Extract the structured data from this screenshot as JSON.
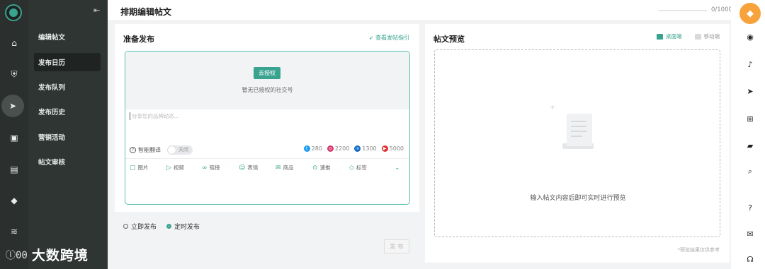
{
  "header": {
    "title": "排期编辑帖文",
    "counter": "0/1000",
    "progress": 0
  },
  "subnav": {
    "items": [
      {
        "label": "编辑帖文"
      },
      {
        "label": "发布日历"
      },
      {
        "label": "发布队列"
      },
      {
        "label": "发布历史"
      },
      {
        "label": "营销活动"
      },
      {
        "label": "帖文审核"
      }
    ],
    "active": "发布日历"
  },
  "rail_icons": [
    "app-logo-icon",
    "home-icon",
    "shield-icon",
    "send-icon",
    "chat-icon",
    "document-icon",
    "tag-icon",
    "layers-icon"
  ],
  "brand": {
    "mark": "ⓛ00",
    "text": "大数跨境"
  },
  "compose": {
    "title": "准备发布",
    "guide_link": "查看发帖指引",
    "auth_button": "去授权",
    "auth_hint": "暂无已授权的社交号",
    "placeholder": "分享您的品牌动态...",
    "translate_label": "智能翻译",
    "translate_toggle": "关闭",
    "limits": [
      {
        "platform": "twitter",
        "value": "280",
        "color": "#1d9bf0"
      },
      {
        "platform": "instagram",
        "value": "2200",
        "color": "#d6336c"
      },
      {
        "platform": "linkedin",
        "value": "1300",
        "color": "#0a66c2"
      },
      {
        "platform": "youtube",
        "value": "5000",
        "color": "#e03131"
      }
    ],
    "tools": [
      {
        "label": "图片",
        "icon": "image-icon"
      },
      {
        "label": "视频",
        "icon": "video-icon"
      },
      {
        "label": "链接",
        "icon": "link-icon"
      },
      {
        "label": "表情",
        "icon": "emoji-icon"
      },
      {
        "label": "商品",
        "icon": "product-icon"
      },
      {
        "label": "速推",
        "icon": "quick-post-icon"
      },
      {
        "label": "标签",
        "icon": "tag-icon"
      }
    ]
  },
  "publish": {
    "options": [
      {
        "label": "立即发布",
        "selected": false
      },
      {
        "label": "定时发布",
        "selected": true
      }
    ],
    "button": "发 布"
  },
  "preview": {
    "title": "帖文预览",
    "tabs": [
      {
        "label": "桌面端",
        "active": true
      },
      {
        "label": "移动端",
        "active": false
      }
    ],
    "hint": "输入帖文内容后即可实时进行预览",
    "note": "*预览结果仅供参考"
  },
  "right_rail_icons": [
    "diamond-icon",
    "logo-icon",
    "bell-icon",
    "send-icon",
    "add-icon",
    "folder-icon",
    "search-icon",
    "help-icon",
    "wechat-icon",
    "headset-icon"
  ],
  "colors": {
    "accent": "#3aa38f",
    "sidebar": "#2f3533",
    "rail": "#2b2f2e",
    "orange": "#f7a23b"
  }
}
